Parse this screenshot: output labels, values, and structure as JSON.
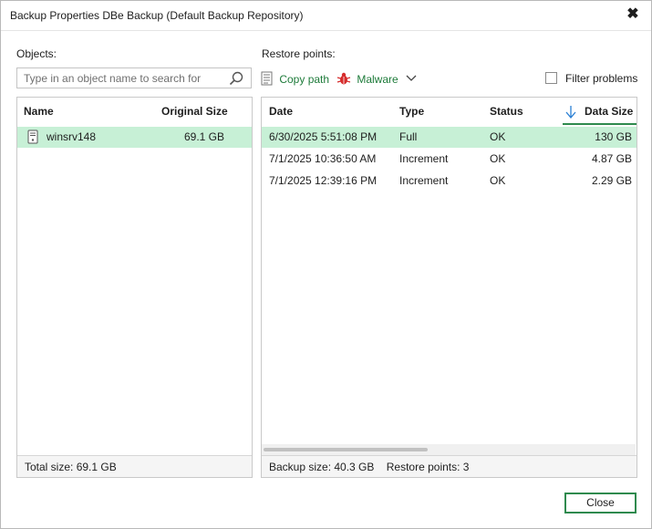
{
  "window": {
    "title": "Backup Properties DBe Backup (Default Backup Repository)",
    "close_glyph": "✖"
  },
  "objects": {
    "label": "Objects:",
    "search_placeholder": "Type in an object name to search for",
    "columns": {
      "name": "Name",
      "size": "Original Size"
    },
    "rows": [
      {
        "name": "winsrv148",
        "size": "69.1 GB",
        "icon": "server-icon"
      }
    ],
    "footer": "Total size: 69.1 GB"
  },
  "restore": {
    "label": "Restore points:",
    "copy_path": "Copy path",
    "malware": "Malware",
    "filter_problems": "Filter problems",
    "columns": {
      "date": "Date",
      "type": "Type",
      "status": "Status",
      "size": "Data Size"
    },
    "rows": [
      {
        "date": "6/30/2025 5:51:08 PM",
        "type": "Full",
        "status": "OK",
        "size": "130 GB"
      },
      {
        "date": "7/1/2025 10:36:50 AM",
        "type": "Increment",
        "status": "OK",
        "size": "4.87 GB"
      },
      {
        "date": "7/1/2025 12:39:16 PM",
        "type": "Increment",
        "status": "OK",
        "size": "2.29 GB"
      }
    ],
    "footer_backup_size": "Backup size: 40.3 GB",
    "footer_restore_points": "Restore points: 3"
  },
  "buttons": {
    "close": "Close"
  },
  "colors": {
    "accent": "#2f8a4e",
    "selected_row": "#c7f0d6",
    "malware": "#d62c2c"
  }
}
